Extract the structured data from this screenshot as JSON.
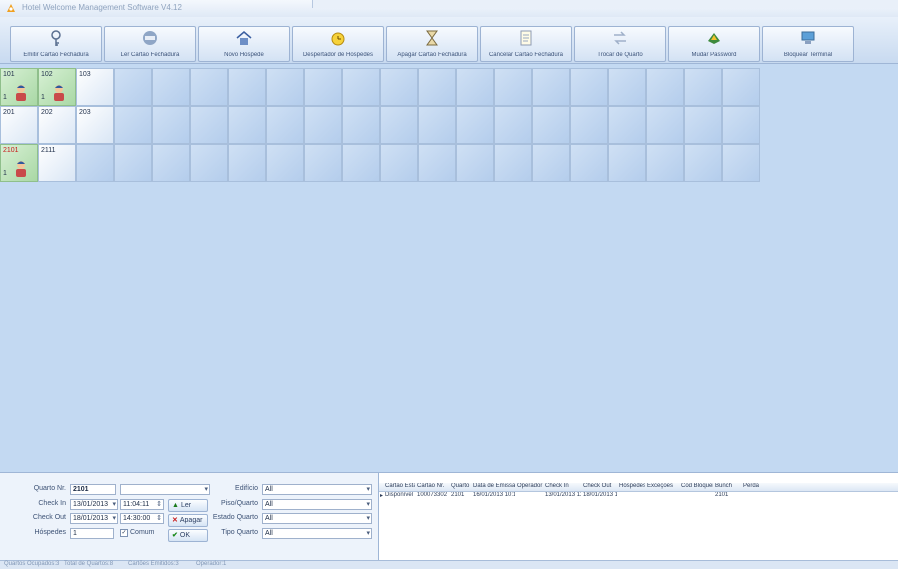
{
  "window": {
    "title": "Hotel Welcome Management Software V4.12"
  },
  "toolbar": {
    "buttons": [
      {
        "label": "Emitir Cartão Fechadura",
        "icon": "key-icon"
      },
      {
        "label": "Ler Cartão Fechadura",
        "icon": "card-reader-icon"
      },
      {
        "label": "Novo Hospede",
        "icon": "home-icon"
      },
      {
        "label": "Despertador de Hospedes",
        "icon": "alarm-clock-icon"
      },
      {
        "label": "Apagar Cartão Fechadura",
        "icon": "hourglass-icon"
      },
      {
        "label": "Cancelar Cartão Fechadura",
        "icon": "document-icon"
      },
      {
        "label": "Trocar de Quarto",
        "icon": "swap-icon"
      },
      {
        "label": "Mudar Password",
        "icon": "password-icon"
      },
      {
        "label": "Bloquear Terminal",
        "icon": "computer-icon"
      }
    ]
  },
  "rooms": [
    {
      "number": "101",
      "guests": "1",
      "state": "occupied",
      "number_color": "normal"
    },
    {
      "number": "102",
      "guests": "1",
      "state": "occupied",
      "number_color": "normal"
    },
    {
      "number": "103",
      "guests": "",
      "state": "vacant",
      "number_color": "normal"
    },
    {
      "number": "201",
      "guests": "",
      "state": "vacant",
      "number_color": "normal"
    },
    {
      "number": "202",
      "guests": "",
      "state": "vacant",
      "number_color": "normal"
    },
    {
      "number": "203",
      "guests": "",
      "state": "vacant",
      "number_color": "normal"
    },
    {
      "number": "2101",
      "guests": "1",
      "state": "occupied",
      "number_color": "red"
    },
    {
      "number": "2111",
      "guests": "",
      "state": "vacant",
      "number_color": "normal"
    }
  ],
  "filters": {
    "room_label": "Quarto Nr.",
    "room_value": "2101",
    "checkin_label": "Check In",
    "checkin_date": "13/01/2013",
    "checkin_time": "11:04:11",
    "checkout_label": "Check Out",
    "checkout_date": "18/01/2013",
    "checkout_time": "14:30:00",
    "persons_label": "Hóspedes",
    "persons_value": "1",
    "common_label": "Comum",
    "btn_read": "Ler",
    "btn_delete": "Apagar",
    "btn_ok": "OK",
    "building_label": "Edifício",
    "building_value": "All",
    "floor_label": "Piso/Quarto",
    "floor_value": "All",
    "state_label": "Estado Quarto",
    "state_value": "All",
    "type_label": "Tipo Quarto",
    "type_value": "All"
  },
  "table": {
    "columns": [
      "Cartão Estado",
      "Cartão Nr.",
      "Quarto Nr.",
      "Data de Emissão",
      "Operador",
      "Check In",
      "Check Out",
      "Hóspedes",
      "Exceções",
      "Cod Bloqueio",
      "Bunch",
      "Perda"
    ],
    "rows": [
      [
        "Disponível",
        "100073302",
        "2101",
        "16/01/2013 10:12",
        "",
        "13/01/2013 11:04",
        "18/01/2013 14:30",
        "",
        "",
        "",
        "2101",
        ""
      ]
    ]
  },
  "statusbar": {
    "items": [
      "Quartos Ocupados:3",
      "Total de Quartos:8",
      "Cartões Emitidos:3",
      "Operador:1"
    ]
  }
}
